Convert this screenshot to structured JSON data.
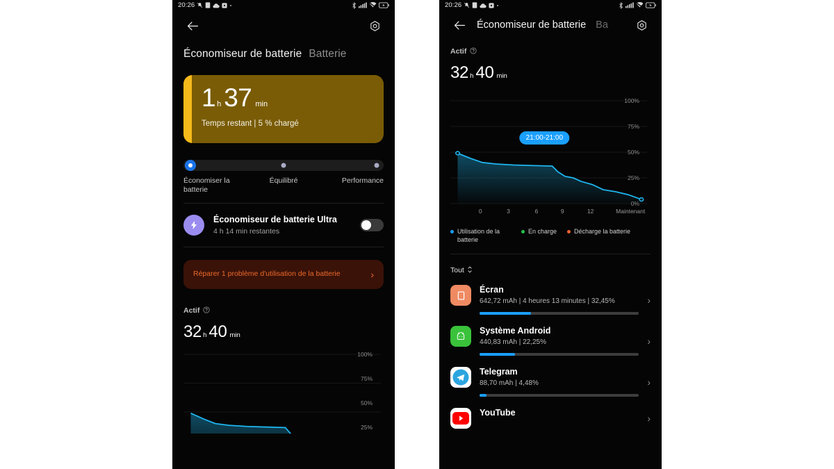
{
  "statusbar": {
    "time": "20:26",
    "left_icons": [
      "silent-mode-icon",
      "sd-card-icon",
      "cloud-upload-icon",
      "app-icon",
      "dot-icon"
    ],
    "right_icons": [
      "bluetooth-icon",
      "signal-bars-icon",
      "wifi-muted-icon",
      "battery-icon"
    ]
  },
  "left_phone": {
    "appbar": {
      "back": "back-arrow-icon",
      "settings": "gear-icon"
    },
    "title": {
      "main": "Économiseur de batterie",
      "sub": "Batterie"
    },
    "battery_card": {
      "hours": "1",
      "hours_unit": "h",
      "minutes": "37",
      "minutes_unit": "min",
      "subtitle": "Temps restant | 5 % chargé",
      "fill_percent": 5,
      "fill_color": "#f6b91a",
      "card_color": "#7a5c06"
    },
    "modes": {
      "selected_index": 0,
      "accent": "#1a73e8",
      "items": [
        {
          "label": "Économiser la batterie"
        },
        {
          "label": "Équilibré"
        },
        {
          "label": "Performance"
        }
      ]
    },
    "ultra": {
      "title": "Économiseur de batterie Ultra",
      "subtitle": "4 h 14 min restantes",
      "icon": "lightning-bolt-icon",
      "icon_color": "#9b8cf0",
      "toggle_on": false
    },
    "repair": {
      "text": "Réparer 1 problème d'utilisation de la batterie",
      "color": "#ee6a2a",
      "background": "#3a1208"
    },
    "actif": {
      "label": "Actif",
      "hours": "32",
      "hours_unit": "h",
      "minutes": "40",
      "minutes_unit": "min"
    }
  },
  "right_phone": {
    "appbar": {
      "back": "back-arrow-icon",
      "title": "Économiseur de batterie",
      "title_faded": "Ba",
      "settings": "gear-icon"
    },
    "actif": {
      "label": "Actif",
      "hours": "32",
      "hours_unit": "h",
      "minutes": "40",
      "minutes_unit": "min"
    },
    "tooltip": "21:00-21:00",
    "legend": [
      {
        "label": "Utilisation de la batterie",
        "color": "#1a9fff"
      },
      {
        "label": "En charge",
        "color": "#25c24a"
      },
      {
        "label": "Décharge la batterie",
        "color": "#f2622a"
      }
    ],
    "sort": {
      "label": "Tout",
      "icon": "sort-updown-icon"
    },
    "apps": [
      {
        "name": "Écran",
        "meta": "642,72 mAh | 4 heures 13 minutes  | 32,45%",
        "percent": 32.45,
        "icon": "screen-icon",
        "icon_bg": "#ef8a62"
      },
      {
        "name": "Système Android",
        "meta": "440,83 mAh | 22,25%",
        "percent": 22.25,
        "icon": "android-robot-icon",
        "icon_bg": "#3ac23a"
      },
      {
        "name": "Telegram",
        "meta": "88,70 mAh | 4,48%",
        "percent": 4.48,
        "icon": "telegram-paper-plane-icon",
        "icon_bg": "#ffffff"
      },
      {
        "name": "YouTube",
        "meta": "",
        "percent": 0,
        "icon": "youtube-play-icon",
        "icon_bg": "#ffffff"
      }
    ]
  },
  "chart_data": {
    "type": "area",
    "title": "",
    "xlabel": "",
    "ylabel": "",
    "ylim": [
      0,
      100
    ],
    "yticks": [
      0,
      25,
      50,
      75,
      100
    ],
    "ytick_labels": [
      "0%",
      "25%",
      "50%",
      "75%",
      "100%"
    ],
    "xticks": [
      0,
      3,
      6,
      9,
      12
    ],
    "xtick_labels": [
      "0",
      "3",
      "6",
      "9",
      "12",
      "Maintenant"
    ],
    "grid": true,
    "line_color": "#1fb6f0",
    "series": [
      {
        "name": "Utilisation de la batterie",
        "x": [
          -1.2,
          0.2,
          1.5,
          3.0,
          5.0,
          7.0,
          9.2,
          9.8,
          10.6,
          11.5,
          12.4,
          13.6,
          14.8,
          16.2,
          17.6,
          19.0
        ],
        "values": [
          49,
          44,
          40,
          38.5,
          37.5,
          37,
          36.5,
          31,
          26.5,
          25,
          21.5,
          18.5,
          13.5,
          11.5,
          8.5,
          4
        ]
      }
    ],
    "markers": [
      {
        "x": -1.2,
        "y": 49
      },
      {
        "x": 19.0,
        "y": 4
      }
    ],
    "annotation": "21:00-21:00"
  }
}
